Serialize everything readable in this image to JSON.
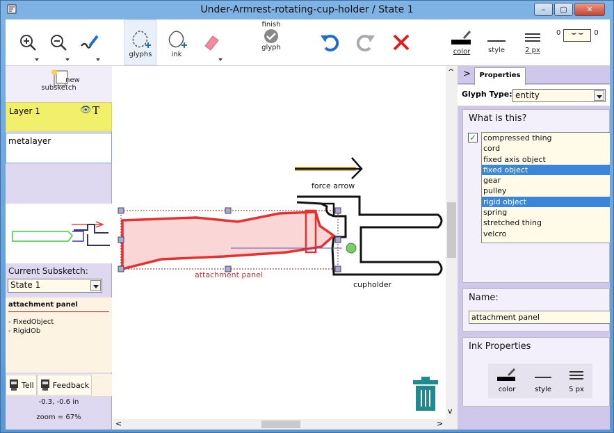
{
  "window": {
    "title": "Under-Armrest-rotating-cup-holder / State 1",
    "minimize": "–",
    "maximize": "▢",
    "close": "✕"
  },
  "toolbar": {
    "glyphs_label": "glyphs",
    "ink_label": "ink",
    "finish_line1": "finish",
    "finish_line2": "glyph",
    "color_label": "color",
    "style_label": "style",
    "width_label": "2 px",
    "tick_left": "0",
    "tick_right": "0"
  },
  "left": {
    "new_line1": "new",
    "new_line2": "subsketch",
    "layer_name": "Layer 1",
    "layer_text_icon": "T",
    "metalayer": "metalayer",
    "current_subsketch_label": "Current Subsketch:",
    "current_subsketch_value": "State 1",
    "glyph_name": "attachment panel",
    "glyph_types": [
      "- FixedObject",
      "- RigidOb"
    ],
    "tell": "Tell",
    "feedback": "Feedback",
    "coords": "-0.3, -0.6 in",
    "zoom": "zoom = 67%"
  },
  "canvas": {
    "force_arrow": "force arrow",
    "attachment_panel": "attachment panel",
    "cupholder": "cupholder"
  },
  "right": {
    "tab_label": "Properties",
    "glyph_type_label": "Glyph Type:",
    "glyph_type_value": "entity",
    "what_heading": "What is this?",
    "options": [
      "compressed thing",
      "cord",
      "fixed axis object",
      "fixed object",
      "gear",
      "pulley",
      "rigid object",
      "spring",
      "stretched thing",
      "velcro"
    ],
    "selected": [
      "fixed object",
      "rigid object"
    ],
    "name_heading": "Name:",
    "name_value": "attachment panel",
    "ink_heading": "Ink Properties",
    "ink_color": "color",
    "ink_style": "style",
    "ink_width": "5 px"
  },
  "colors": {
    "accent": "#3b86d8",
    "layer_bg": "#f2f06a",
    "panel_bg": "#cfc8ea",
    "selection_red": "#e83030"
  }
}
